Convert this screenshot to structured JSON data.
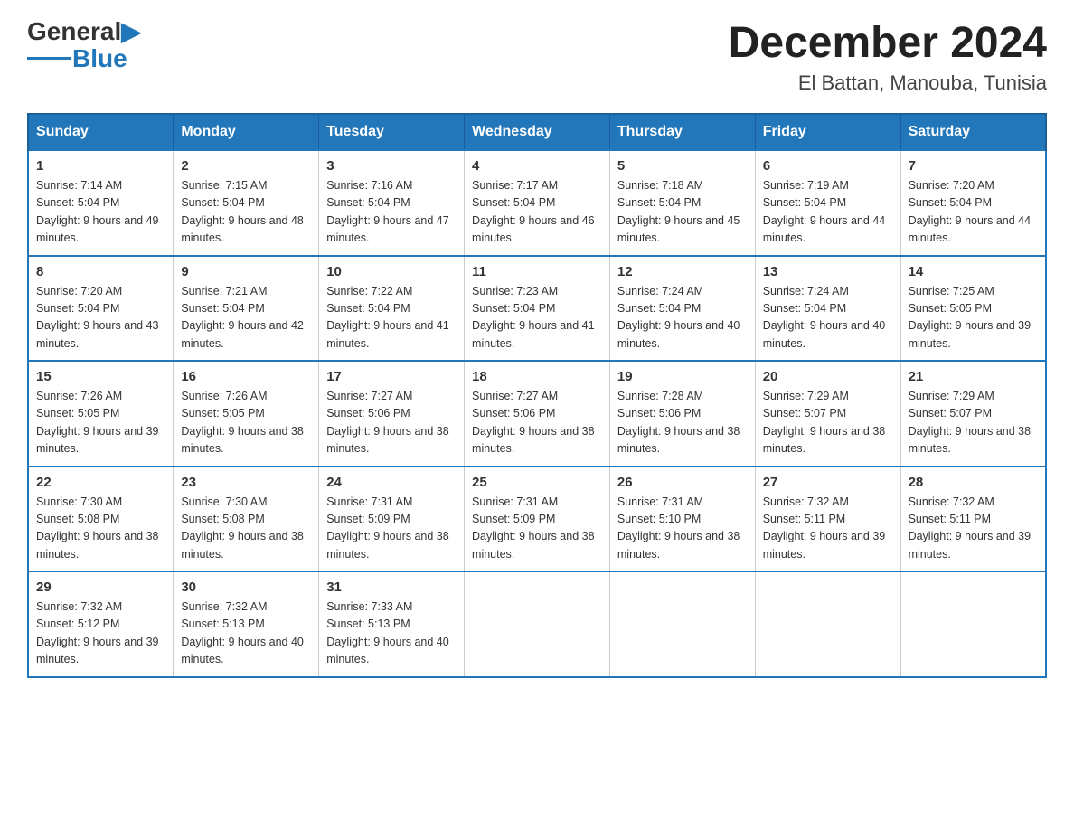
{
  "logo": {
    "text_general": "General",
    "text_blue": "Blue"
  },
  "title": "December 2024",
  "location": "El Battan, Manouba, Tunisia",
  "days_of_week": [
    "Sunday",
    "Monday",
    "Tuesday",
    "Wednesday",
    "Thursday",
    "Friday",
    "Saturday"
  ],
  "weeks": [
    [
      {
        "day": "1",
        "sunrise": "7:14 AM",
        "sunset": "5:04 PM",
        "daylight": "9 hours and 49 minutes."
      },
      {
        "day": "2",
        "sunrise": "7:15 AM",
        "sunset": "5:04 PM",
        "daylight": "9 hours and 48 minutes."
      },
      {
        "day": "3",
        "sunrise": "7:16 AM",
        "sunset": "5:04 PM",
        "daylight": "9 hours and 47 minutes."
      },
      {
        "day": "4",
        "sunrise": "7:17 AM",
        "sunset": "5:04 PM",
        "daylight": "9 hours and 46 minutes."
      },
      {
        "day": "5",
        "sunrise": "7:18 AM",
        "sunset": "5:04 PM",
        "daylight": "9 hours and 45 minutes."
      },
      {
        "day": "6",
        "sunrise": "7:19 AM",
        "sunset": "5:04 PM",
        "daylight": "9 hours and 44 minutes."
      },
      {
        "day": "7",
        "sunrise": "7:20 AM",
        "sunset": "5:04 PM",
        "daylight": "9 hours and 44 minutes."
      }
    ],
    [
      {
        "day": "8",
        "sunrise": "7:20 AM",
        "sunset": "5:04 PM",
        "daylight": "9 hours and 43 minutes."
      },
      {
        "day": "9",
        "sunrise": "7:21 AM",
        "sunset": "5:04 PM",
        "daylight": "9 hours and 42 minutes."
      },
      {
        "day": "10",
        "sunrise": "7:22 AM",
        "sunset": "5:04 PM",
        "daylight": "9 hours and 41 minutes."
      },
      {
        "day": "11",
        "sunrise": "7:23 AM",
        "sunset": "5:04 PM",
        "daylight": "9 hours and 41 minutes."
      },
      {
        "day": "12",
        "sunrise": "7:24 AM",
        "sunset": "5:04 PM",
        "daylight": "9 hours and 40 minutes."
      },
      {
        "day": "13",
        "sunrise": "7:24 AM",
        "sunset": "5:04 PM",
        "daylight": "9 hours and 40 minutes."
      },
      {
        "day": "14",
        "sunrise": "7:25 AM",
        "sunset": "5:05 PM",
        "daylight": "9 hours and 39 minutes."
      }
    ],
    [
      {
        "day": "15",
        "sunrise": "7:26 AM",
        "sunset": "5:05 PM",
        "daylight": "9 hours and 39 minutes."
      },
      {
        "day": "16",
        "sunrise": "7:26 AM",
        "sunset": "5:05 PM",
        "daylight": "9 hours and 38 minutes."
      },
      {
        "day": "17",
        "sunrise": "7:27 AM",
        "sunset": "5:06 PM",
        "daylight": "9 hours and 38 minutes."
      },
      {
        "day": "18",
        "sunrise": "7:27 AM",
        "sunset": "5:06 PM",
        "daylight": "9 hours and 38 minutes."
      },
      {
        "day": "19",
        "sunrise": "7:28 AM",
        "sunset": "5:06 PM",
        "daylight": "9 hours and 38 minutes."
      },
      {
        "day": "20",
        "sunrise": "7:29 AM",
        "sunset": "5:07 PM",
        "daylight": "9 hours and 38 minutes."
      },
      {
        "day": "21",
        "sunrise": "7:29 AM",
        "sunset": "5:07 PM",
        "daylight": "9 hours and 38 minutes."
      }
    ],
    [
      {
        "day": "22",
        "sunrise": "7:30 AM",
        "sunset": "5:08 PM",
        "daylight": "9 hours and 38 minutes."
      },
      {
        "day": "23",
        "sunrise": "7:30 AM",
        "sunset": "5:08 PM",
        "daylight": "9 hours and 38 minutes."
      },
      {
        "day": "24",
        "sunrise": "7:31 AM",
        "sunset": "5:09 PM",
        "daylight": "9 hours and 38 minutes."
      },
      {
        "day": "25",
        "sunrise": "7:31 AM",
        "sunset": "5:09 PM",
        "daylight": "9 hours and 38 minutes."
      },
      {
        "day": "26",
        "sunrise": "7:31 AM",
        "sunset": "5:10 PM",
        "daylight": "9 hours and 38 minutes."
      },
      {
        "day": "27",
        "sunrise": "7:32 AM",
        "sunset": "5:11 PM",
        "daylight": "9 hours and 39 minutes."
      },
      {
        "day": "28",
        "sunrise": "7:32 AM",
        "sunset": "5:11 PM",
        "daylight": "9 hours and 39 minutes."
      }
    ],
    [
      {
        "day": "29",
        "sunrise": "7:32 AM",
        "sunset": "5:12 PM",
        "daylight": "9 hours and 39 minutes."
      },
      {
        "day": "30",
        "sunrise": "7:32 AM",
        "sunset": "5:13 PM",
        "daylight": "9 hours and 40 minutes."
      },
      {
        "day": "31",
        "sunrise": "7:33 AM",
        "sunset": "5:13 PM",
        "daylight": "9 hours and 40 minutes."
      },
      null,
      null,
      null,
      null
    ]
  ]
}
